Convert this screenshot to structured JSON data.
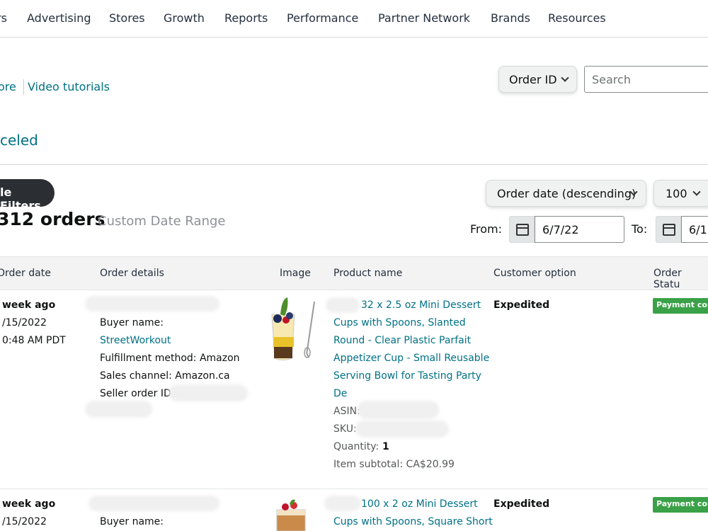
{
  "nav": {
    "items": [
      "rs",
      "Advertising",
      "Stores",
      "Growth",
      "Reports",
      "Performance",
      "Partner Network",
      "Brands",
      "Resources"
    ]
  },
  "links": {
    "learn_more": "ore",
    "video_tutorials": "Video tutorials"
  },
  "search": {
    "type_label": "Order ID",
    "placeholder": "Search"
  },
  "status_tab": "celed",
  "filters_button": "le Filters",
  "orders_count": "312 orders",
  "date_range_label": "Custom Date Range",
  "sort": {
    "label": "Order date (descending)",
    "page_size": "100"
  },
  "date_filter": {
    "from_label": "From:",
    "from_value": "6/7/22",
    "to_label": "To:",
    "to_value": "6/1"
  },
  "table": {
    "headers": [
      "Order date",
      "Order details",
      "Image",
      "Product name",
      "Customer option",
      "Order Statu"
    ],
    "rows": [
      {
        "date_ago": "week ago",
        "date": "/15/2022",
        "time": "0:48 AM PDT",
        "buyer_label": "Buyer name:",
        "buyer_name": "StreetWorkout",
        "fulfillment": "Fulfillment method: Amazon",
        "channel": "Sales channel: Amazon.ca",
        "seller_order_id": "Seller order ID:",
        "product_lines": [
          "32 x 2.5 oz Mini Dessert",
          "Cups with Spoons, Slanted",
          "Round - Clear Plastic Parfait",
          "Appetizer Cup - Small Reusable",
          "Serving Bowl for Tasting Party",
          "De"
        ],
        "asin_label": "ASIN:",
        "sku_label": "SKU:",
        "quantity_label": "Quantity:",
        "quantity": "1",
        "subtotal": "Item subtotal: CA$20.99",
        "customer_option": "Expedited",
        "status": "Payment com"
      },
      {
        "date_ago": "week ago",
        "date": "/15/2022",
        "buyer_label": "Buyer name:",
        "product_lines": [
          "100 x 2 oz Mini Dessert",
          "Cups with Spoons, Square Short"
        ],
        "customer_option": "Expedited",
        "status": "Payment com"
      }
    ]
  },
  "colors": {
    "link": "#007185",
    "badge_green": "#3aa148",
    "pill_dark": "#2b2f33"
  }
}
